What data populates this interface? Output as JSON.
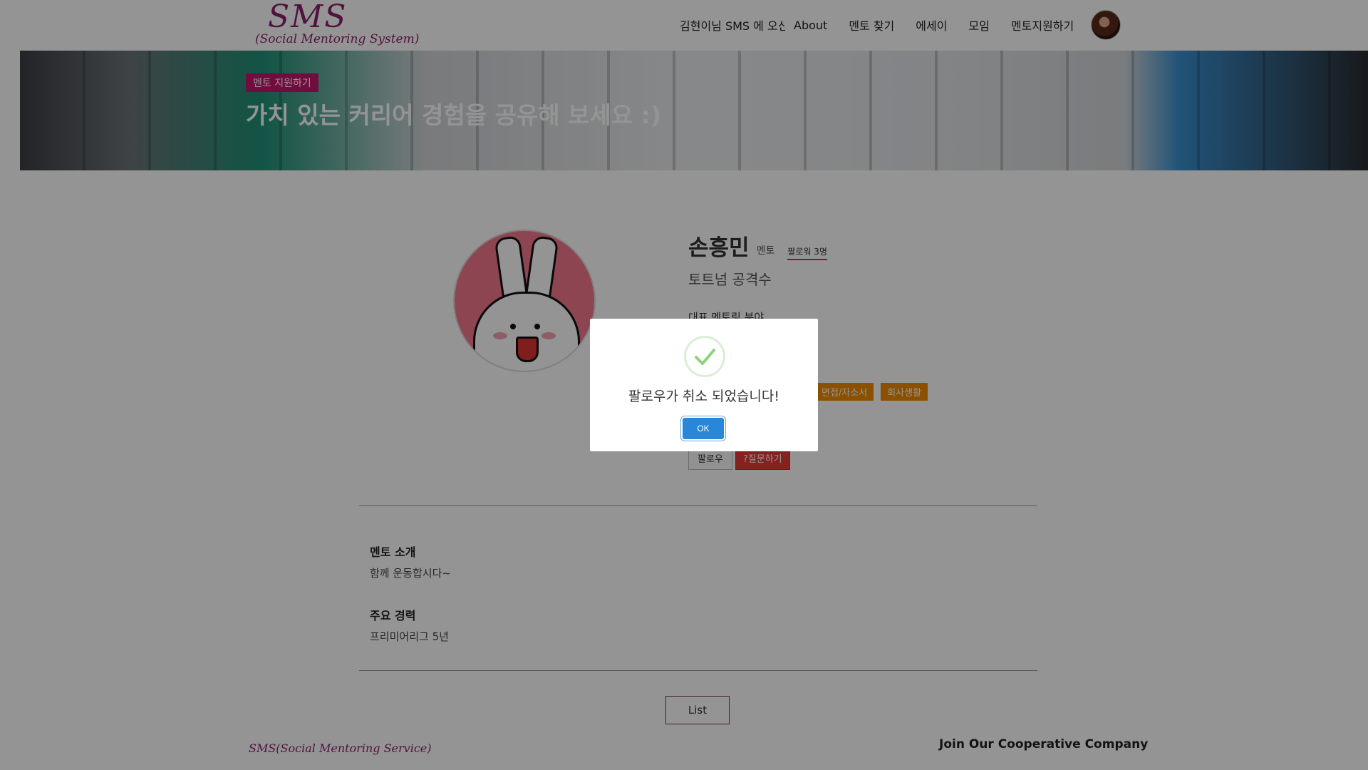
{
  "header": {
    "logo_main": "SMS",
    "logo_sub": "(Social Mentoring System)",
    "greeting": "김현이님 SMS 에 오신 것을 환영합니다",
    "nav": [
      "About",
      "멘토 찾기",
      "에세이",
      "모임",
      "멘토지원하기"
    ]
  },
  "hero": {
    "tag": "멘토 지원하기",
    "title": "가치 있는 커리어 경험을 공유해 보세요 :)"
  },
  "profile": {
    "name": "손흥민",
    "role": "멘토",
    "followers": "팔로워 3명",
    "subtitle": "토트넘 공격수",
    "rep_label": "대표 멘토링 분야",
    "tags": [
      "면접/자소서",
      "회사생활"
    ],
    "follow_label": "팔로우",
    "ask_label": "?질문하기"
  },
  "sections": {
    "intro_title": "멘토 소개",
    "intro_body": "함께 운동합시다~",
    "career_title": "주요 경력",
    "career_body": "프리미어리그 5년"
  },
  "list_label": "List",
  "footer": {
    "logo": "SMS(Social Mentoring Service)",
    "join": "Join Our Cooperative Company"
  },
  "modal": {
    "message": "팔로우가 취소 되었습니다!",
    "ok_label": "OK"
  },
  "colors": {
    "brand": "#8a1f6b",
    "tag_orange": "#f08a00",
    "ask_red": "#e53935",
    "ok_blue": "#2a86d6"
  }
}
